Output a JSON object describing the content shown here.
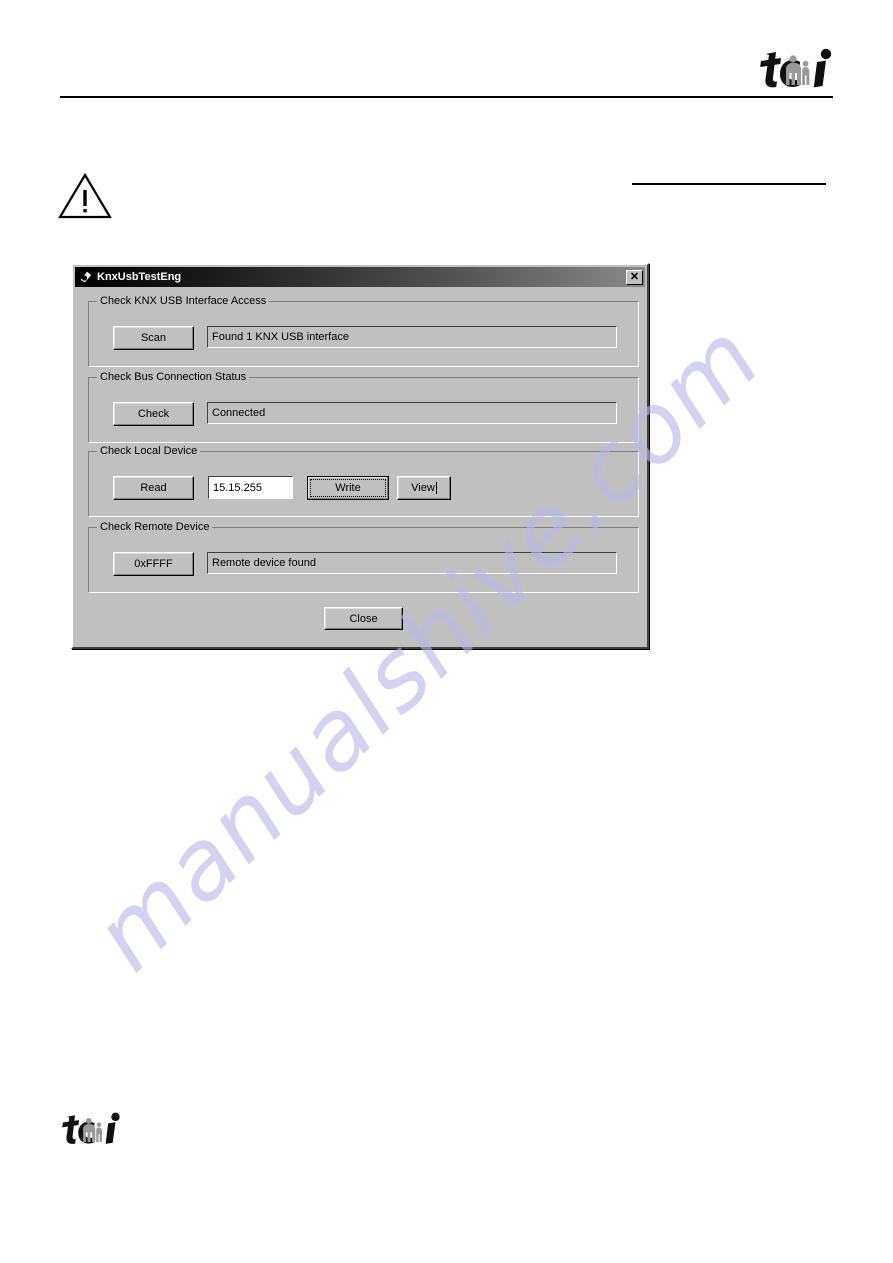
{
  "page": {
    "brand_logo_alt": "tci",
    "warning_icon": "warning-triangle-icon"
  },
  "dialog": {
    "title": "KnxUsbTestEng",
    "title_icon": "app-icon",
    "close_label": "✕",
    "groups": [
      {
        "id": "interface-access",
        "label": "Check KNX USB Interface Access",
        "button": "Scan",
        "status": "Found 1 KNX USB interface"
      },
      {
        "id": "bus-connection",
        "label": "Check Bus Connection Status",
        "button": "Check",
        "status": "Connected"
      },
      {
        "id": "local-device",
        "label": "Check Local Device",
        "button": "Read",
        "address_value": "15.15.255",
        "address_placeholder": "",
        "write_button": "Write",
        "view_button": "View"
      },
      {
        "id": "remote-device",
        "label": "Check Remote Device",
        "button": "0xFFFF",
        "status": "Remote device found"
      }
    ],
    "close_button": "Close"
  },
  "watermark": {
    "text": "manualshive.com",
    "color": "#b9b8e8"
  }
}
